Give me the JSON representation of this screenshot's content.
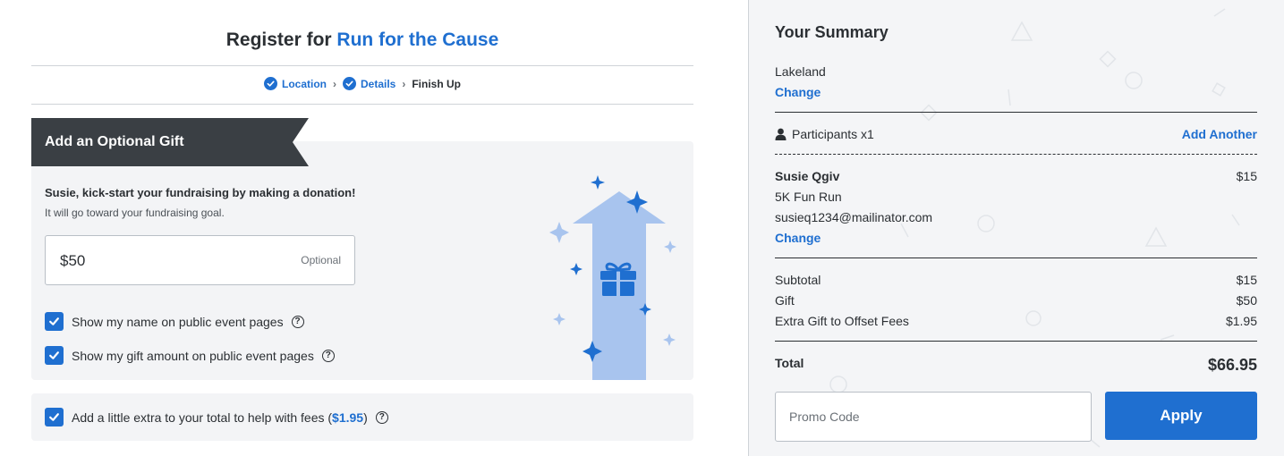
{
  "header": {
    "title_prefix": "Register for",
    "event_name": "Run for the Cause"
  },
  "steps": {
    "items": [
      {
        "label": "Location",
        "state": "complete"
      },
      {
        "label": "Details",
        "state": "complete"
      },
      {
        "label": "Finish Up",
        "state": "current"
      }
    ],
    "separator": "›"
  },
  "gift": {
    "banner_title": "Add an Optional Gift",
    "lead": "Susie, kick-start your fundraising by making a donation!",
    "sublead": "It will go toward your fundraising goal.",
    "amount_value": "$50",
    "amount_hint": "Optional",
    "show_name_label": "Show my name on public event pages",
    "show_name_checked": true,
    "show_amount_label": "Show my gift amount on public event pages",
    "show_amount_checked": true,
    "help_glyph": "?"
  },
  "fees": {
    "label_before": "Add a little extra to your total to help with fees (",
    "amount": "$1.95",
    "label_after": ")",
    "checked": true
  },
  "summary": {
    "title": "Your Summary",
    "location": "Lakeland",
    "change_label": "Change",
    "participants_label": "Participants x1",
    "add_another_label": "Add Another",
    "participant": {
      "name": "Susie Qgiv",
      "price": "$15",
      "event": "5K Fun Run",
      "email": "susieq1234@mailinator.com"
    },
    "rows": [
      {
        "label": "Subtotal",
        "value": "$15"
      },
      {
        "label": "Gift",
        "value": "$50"
      },
      {
        "label": "Extra Gift to Offset Fees",
        "value": "$1.95"
      }
    ],
    "total_label": "Total",
    "total_value": "$66.95",
    "promo_placeholder": "Promo Code",
    "apply_label": "Apply"
  },
  "colors": {
    "accent": "#1f6fd0",
    "banner": "#3a3f44",
    "card_bg": "#f3f4f6",
    "arrow": "#a8c4ee"
  },
  "icons": {
    "step_complete": "check-circle-icon",
    "help": "question-circle-icon",
    "participant": "person-icon",
    "illustration": "gift-arrow-illustration"
  }
}
